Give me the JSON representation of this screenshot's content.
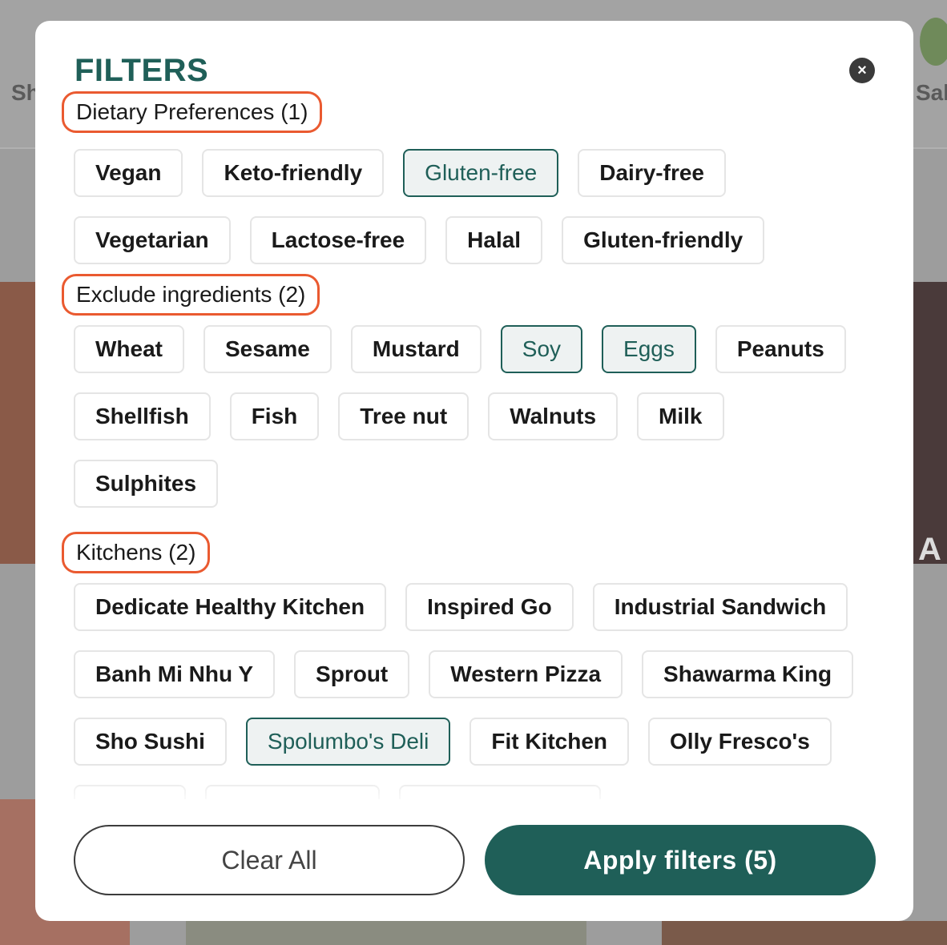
{
  "background": {
    "categories_left": "Sh",
    "categories_right": "Sal",
    "partial_text": "A"
  },
  "modal": {
    "title": "FILTERS",
    "close_label": "×",
    "sections": {
      "dietary": {
        "label": "Dietary Preferences (1)"
      },
      "exclude": {
        "label": "Exclude ingredients (2)"
      },
      "kitchens": {
        "label": "Kitchens (2)"
      }
    },
    "dietary_chips": [
      {
        "label": "Vegan",
        "selected": false
      },
      {
        "label": "Keto-friendly",
        "selected": false
      },
      {
        "label": "Gluten-free",
        "selected": true
      },
      {
        "label": "Dairy-free",
        "selected": false
      },
      {
        "label": "Vegetarian",
        "selected": false
      },
      {
        "label": "Lactose-free",
        "selected": false
      },
      {
        "label": "Halal",
        "selected": false
      },
      {
        "label": "Gluten-friendly",
        "selected": false
      }
    ],
    "exclude_chips": [
      {
        "label": "Wheat",
        "selected": false
      },
      {
        "label": "Sesame",
        "selected": false
      },
      {
        "label": "Mustard",
        "selected": false
      },
      {
        "label": "Soy",
        "selected": true
      },
      {
        "label": "Eggs",
        "selected": true
      },
      {
        "label": "Peanuts",
        "selected": false
      },
      {
        "label": "Shellfish",
        "selected": false
      },
      {
        "label": "Fish",
        "selected": false
      },
      {
        "label": "Tree nut",
        "selected": false
      },
      {
        "label": "Walnuts",
        "selected": false
      },
      {
        "label": "Milk",
        "selected": false
      },
      {
        "label": "Sulphites",
        "selected": false
      }
    ],
    "kitchen_chips": [
      {
        "label": "Dedicate Healthy Kitchen",
        "selected": false
      },
      {
        "label": "Inspired Go",
        "selected": false
      },
      {
        "label": "Industrial Sandwich",
        "selected": false
      },
      {
        "label": "Banh Mi Nhu Y",
        "selected": false
      },
      {
        "label": "Sprout",
        "selected": false
      },
      {
        "label": "Western Pizza",
        "selected": false
      },
      {
        "label": "Shawarma King",
        "selected": false
      },
      {
        "label": "Sho Sushi",
        "selected": false
      },
      {
        "label": "Spolumbo's Deli",
        "selected": true
      },
      {
        "label": "Fit Kitchen",
        "selected": false
      },
      {
        "label": "Olly Fresco's",
        "selected": false
      }
    ],
    "clear_label": "Clear All",
    "apply_label": "Apply filters (5)"
  },
  "colors": {
    "brand": "#1f5f58",
    "section_outline": "#ea5a30",
    "selected_chip_bg": "#eef2f2"
  }
}
